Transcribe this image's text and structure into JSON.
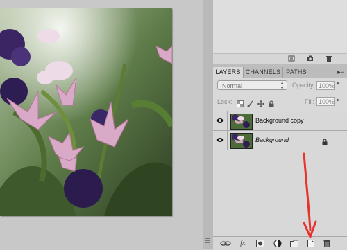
{
  "canvas": {
    "image_description_icon": "flower-photo"
  },
  "upper_toolbar": {
    "icons": [
      "paragraph-list-icon",
      "camera-icon",
      "trash-icon"
    ]
  },
  "layers_panel": {
    "tabs": [
      {
        "label": "LAYERS",
        "active": true
      },
      {
        "label": "CHANNELS",
        "active": false
      },
      {
        "label": "PATHS",
        "active": false
      }
    ],
    "blend_mode": "Normal",
    "opacity_label": "Opacity:",
    "opacity_value": "100%",
    "lock_label": "Lock:",
    "fill_label": "Fill:",
    "fill_value": "100%",
    "layers": [
      {
        "name": "Background copy",
        "italic": false,
        "locked": false,
        "visible": true
      },
      {
        "name": "Background",
        "italic": true,
        "locked": true,
        "visible": true
      }
    ],
    "bottom_icons": [
      "link-layers-icon",
      "fx-icon",
      "add-mask-icon",
      "adjustment-layer-icon",
      "new-group-icon",
      "new-layer-icon",
      "delete-layer-icon"
    ]
  },
  "annotation": {
    "arrow_color": "#e8322c",
    "points_to": "new-layer-icon"
  }
}
